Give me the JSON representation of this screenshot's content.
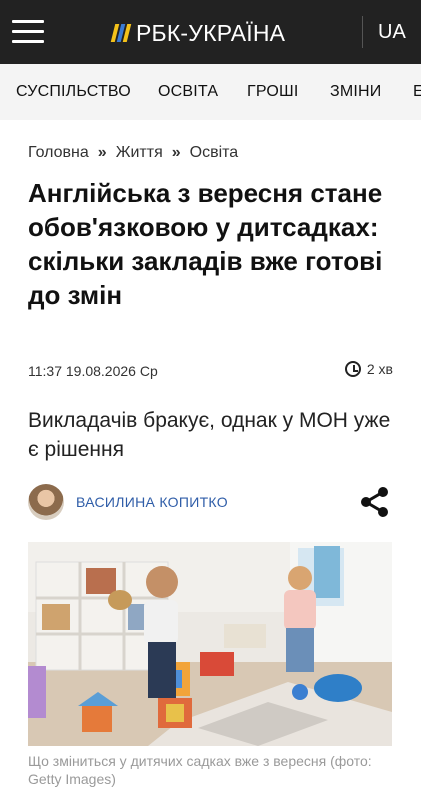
{
  "header": {
    "logo_text": "РБК-УКРАЇНА",
    "language": "UA"
  },
  "categories": [
    "СУСПІЛЬСТВО",
    "ОСВІТА",
    "ГРОШІ",
    "ЗМІНИ",
    "Е"
  ],
  "breadcrumbs": [
    "Головна",
    "Життя",
    "Освіта"
  ],
  "breadcrumb_separator": "»",
  "article": {
    "title": "Англійська з вересня стане обов'язковою у дитсадках: скільки закладів вже готові до змін",
    "published": "11:37 19.08.2026 Ср",
    "read_time": "2 хв",
    "lead": "Викладачів бракує, однак у МОН уже є рішення",
    "author": "ВАСИЛИНА КОПИТКО",
    "image_caption": "Що зміниться у дитячих садках вже з вересня (фото: Getty Images)"
  },
  "colors": {
    "header_bg": "#222222",
    "category_bar_bg": "#f4f4f4",
    "author_link": "#2f5da8",
    "caption": "#9a9a9a"
  },
  "icons": [
    "menu-icon",
    "logo-mark-icon",
    "clock-icon",
    "share-icon"
  ]
}
